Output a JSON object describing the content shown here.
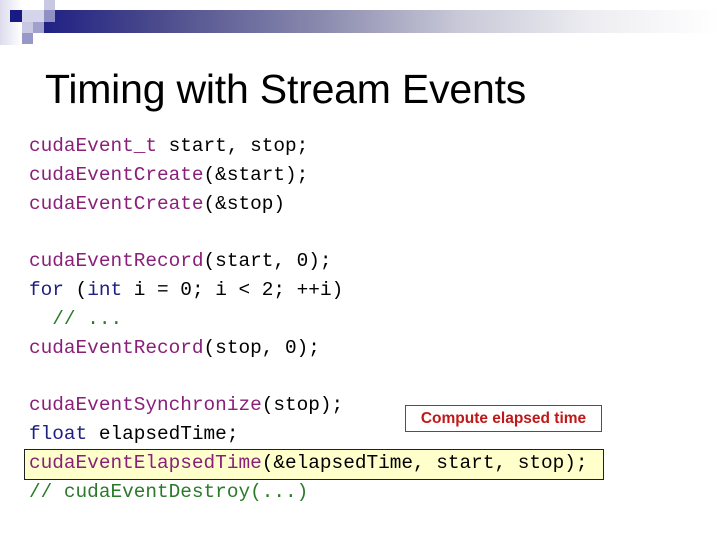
{
  "slide": {
    "title": "Timing with Stream Events",
    "colors": {
      "header_bar_start": "#1c1c84",
      "function": "#8a1f7a",
      "keyword": "#1f1f80",
      "comment": "#2a7a2a",
      "highlight_bg": "#ffffcc",
      "callout_text": "#c01818"
    }
  },
  "code": {
    "block1": [
      [
        {
          "t": "fn",
          "s": "cudaEvent_t"
        },
        {
          "t": "pl",
          "s": " start, stop;"
        }
      ],
      [
        {
          "t": "fn",
          "s": "cudaEventCreate"
        },
        {
          "t": "pl",
          "s": "(&start);"
        }
      ],
      [
        {
          "t": "fn",
          "s": "cudaEventCreate"
        },
        {
          "t": "pl",
          "s": "(&stop)"
        }
      ]
    ],
    "block2": [
      [
        {
          "t": "fn",
          "s": "cudaEventRecord"
        },
        {
          "t": "pl",
          "s": "(start, 0);"
        }
      ],
      [
        {
          "t": "kw",
          "s": "for"
        },
        {
          "t": "pl",
          "s": " ("
        },
        {
          "t": "kw",
          "s": "int"
        },
        {
          "t": "pl",
          "s": " i = 0; i < 2; ++i)"
        }
      ],
      [
        {
          "t": "pl",
          "s": "  "
        },
        {
          "t": "cm",
          "s": "// ..."
        }
      ],
      [
        {
          "t": "fn",
          "s": "cudaEventRecord"
        },
        {
          "t": "pl",
          "s": "(stop, 0);"
        }
      ]
    ],
    "block3": [
      [
        {
          "t": "fn",
          "s": "cudaEventSynchronize"
        },
        {
          "t": "pl",
          "s": "(stop);"
        }
      ],
      [
        {
          "t": "kw",
          "s": "float"
        },
        {
          "t": "pl",
          "s": " elapsedTime;"
        }
      ],
      [
        {
          "t": "fn",
          "s": "cudaEventElapsedTime"
        },
        {
          "t": "pl",
          "s": "(&elapsedTime, start, stop);"
        }
      ],
      [
        {
          "t": "cm",
          "s": "// cudaEventDestroy(...)"
        }
      ]
    ]
  },
  "callout": {
    "label": "Compute elapsed time",
    "highlighted_line": "cudaEventElapsedTime(&elapsedTime, start, stop);"
  }
}
